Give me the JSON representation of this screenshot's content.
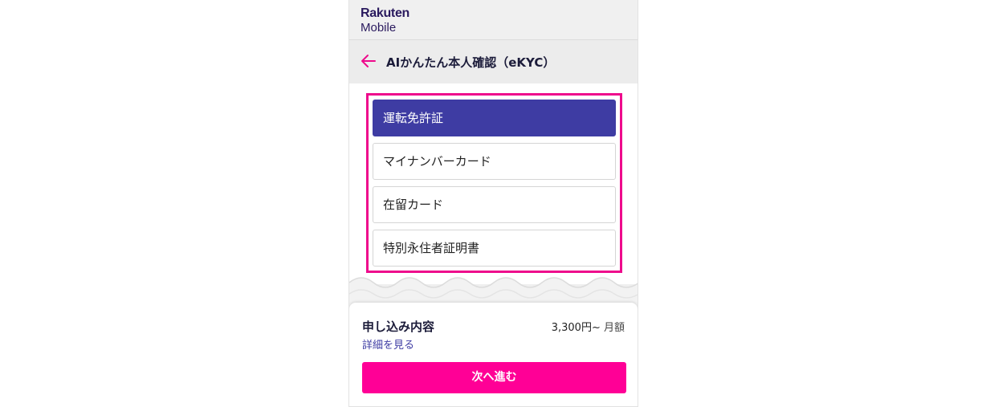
{
  "brand": {
    "line1": "Rakuten",
    "line2": "Mobile"
  },
  "header": {
    "back_icon": "arrow-left-icon",
    "title": "AIかんたん本人確認（eKYC）"
  },
  "document_options": [
    {
      "label": "運転免許証",
      "selected": true
    },
    {
      "label": "マイナンバーカード",
      "selected": false
    },
    {
      "label": "在留カード",
      "selected": false
    },
    {
      "label": "特別永住者証明書",
      "selected": false
    }
  ],
  "summary": {
    "title": "申し込み内容",
    "details_link": "詳細を見る",
    "price": "3,300円~",
    "price_unit": "月額"
  },
  "next_button": {
    "label": "次へ進む"
  },
  "colors": {
    "accent_pink": "#ff0096",
    "highlight_border": "#ee0a8c",
    "selected_option": "#3e3ca3",
    "brand_text": "#2a1a5e",
    "brand_red": "#bf0000"
  }
}
